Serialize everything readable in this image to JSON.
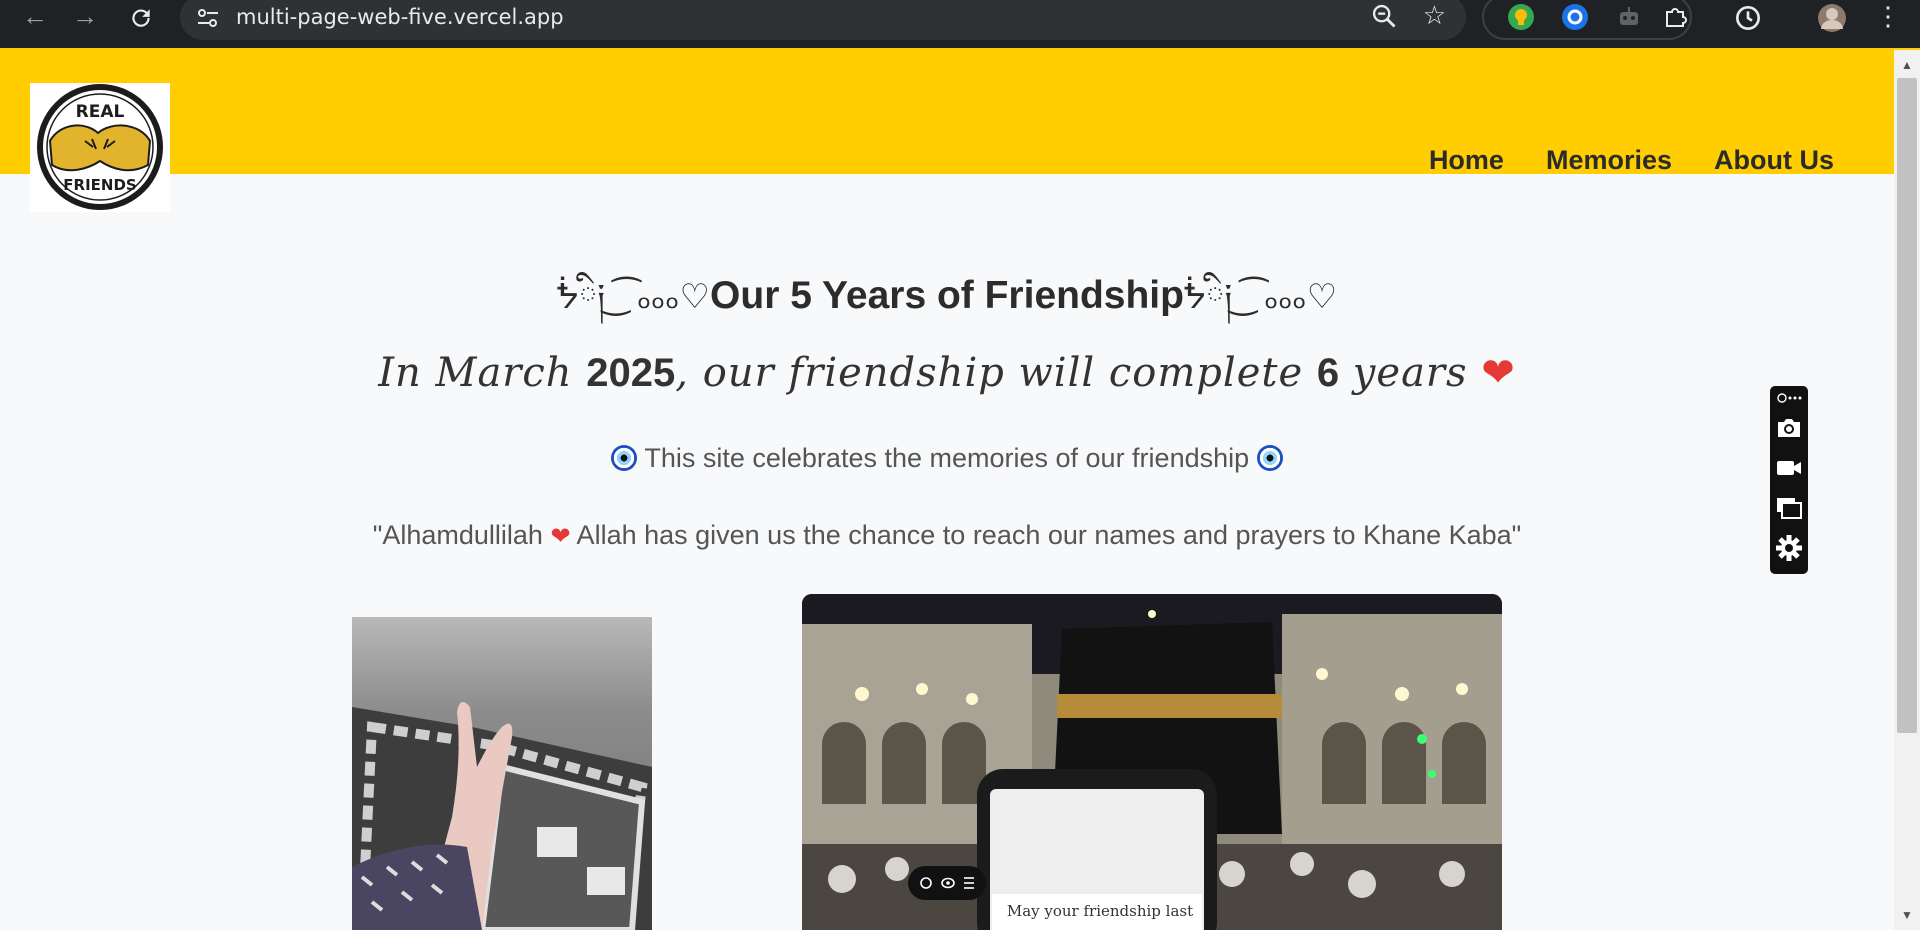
{
  "browser": {
    "url": "multi-page-web-five.vercel.app",
    "icons": [
      "back-icon",
      "forward-icon",
      "reload-icon",
      "site-settings-icon",
      "zoom-icon",
      "bookmark-star-icon",
      "extension-icons",
      "puzzle-icon",
      "history-icon",
      "profile-avatar",
      "kebab-menu-icon"
    ]
  },
  "site": {
    "logo": {
      "line1": "REAL",
      "line2": "FRIENDS"
    },
    "nav": [
      "Home",
      "Memories",
      "About Us"
    ],
    "headline": {
      "deco_left": "ᖭི༏ ͜ ͡ ₒₒₒ♡",
      "text": "Our 5 Years of Friendship",
      "deco_right": "ᖭི༏ ͜ ͡ ₒₒₒ♡"
    },
    "subline": {
      "part1": "In March ",
      "year": "2025",
      "part2": ", our friendship will complete ",
      "count": "6",
      "part3": " years ",
      "heart": "❤"
    },
    "tagline": "This site celebrates the memories of our friendship",
    "quote": {
      "part1": "\"Alhamdullilah ",
      "heart": "❤",
      "part2": " Allah has given us the chance to reach our names and prayers to Khane Kaba\""
    },
    "photo_caption": "May your friendship last"
  },
  "colors": {
    "header": "#ffcd00",
    "page_bg": "#f8f9fb",
    "heart": "#e53935"
  }
}
